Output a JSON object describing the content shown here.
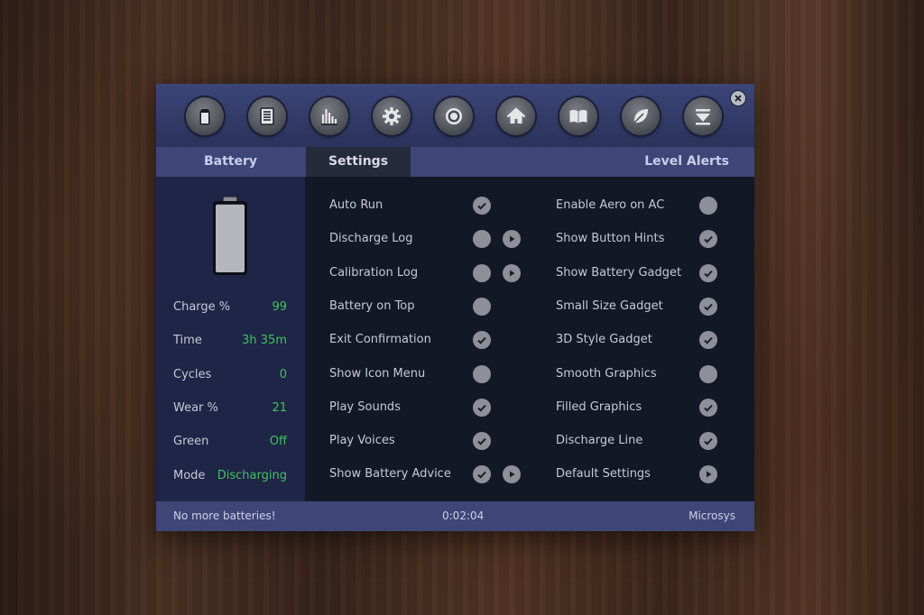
{
  "window": {
    "toolbar": {
      "buttons": [
        {
          "name": "battery-icon"
        },
        {
          "name": "log-list-icon"
        },
        {
          "name": "bar-chart-icon"
        },
        {
          "name": "gear-icon"
        },
        {
          "name": "target-icon"
        },
        {
          "name": "home-icon"
        },
        {
          "name": "book-icon"
        },
        {
          "name": "leaf-icon"
        },
        {
          "name": "minimize-icon"
        }
      ]
    },
    "tabs": {
      "battery": "Battery",
      "settings": "Settings",
      "alerts": "Level Alerts"
    },
    "battery_panel": {
      "charge_percent": 99,
      "stats": [
        {
          "label": "Charge %",
          "value": "99"
        },
        {
          "label": "Time",
          "value": "3h 35m"
        },
        {
          "label": "Cycles",
          "value": "0"
        },
        {
          "label": "Wear %",
          "value": "21"
        },
        {
          "label": "Green",
          "value": "Off"
        },
        {
          "label": "Mode",
          "value": "Discharging"
        }
      ]
    },
    "settings": {
      "left_column": [
        {
          "label": "Auto Run",
          "checked": true,
          "arrow": false
        },
        {
          "label": "Discharge Log",
          "checked": false,
          "arrow": true
        },
        {
          "label": "Calibration Log",
          "checked": false,
          "arrow": true
        },
        {
          "label": "Battery on Top",
          "checked": false,
          "arrow": false
        },
        {
          "label": "Exit Confirmation",
          "checked": true,
          "arrow": false
        },
        {
          "label": "Show Icon Menu",
          "checked": false,
          "arrow": false
        },
        {
          "label": "Play Sounds",
          "checked": true,
          "arrow": false
        },
        {
          "label": "Play Voices",
          "checked": true,
          "arrow": false
        },
        {
          "label": "Show Battery Advice",
          "checked": true,
          "arrow": true
        }
      ],
      "right_column": [
        {
          "label": "Enable Aero on AC",
          "checked": false,
          "arrow": false
        },
        {
          "label": "Show Button Hints",
          "checked": true,
          "arrow": false
        },
        {
          "label": "Show Battery Gadget",
          "checked": true,
          "arrow": false
        },
        {
          "label": "Small Size Gadget",
          "checked": true,
          "arrow": false
        },
        {
          "label": "3D Style Gadget",
          "checked": true,
          "arrow": false
        },
        {
          "label": "Smooth Graphics",
          "checked": false,
          "arrow": false
        },
        {
          "label": "Filled Graphics",
          "checked": true,
          "arrow": false
        },
        {
          "label": "Discharge Line",
          "checked": true,
          "arrow": false
        },
        {
          "label": "Default Settings",
          "checked": null,
          "arrow": true
        }
      ]
    },
    "status": {
      "message": "No more batteries!",
      "timer": "0:02:04",
      "brand": "Microsys"
    },
    "colors": {
      "toolbar": "#3b4578",
      "tab_bar": "#3e4678",
      "panel": "#1f2547",
      "main": "#121826",
      "value_green": "#3ec25c",
      "toggle": "#8d9098"
    }
  }
}
